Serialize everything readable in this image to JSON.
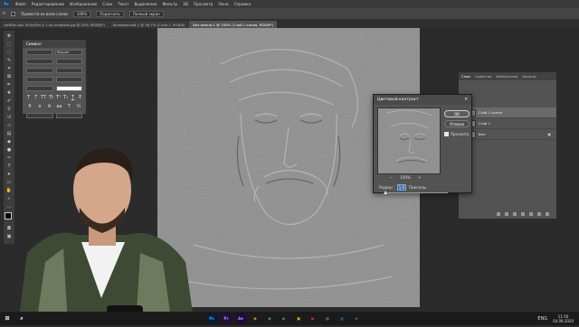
{
  "menubar": {
    "logo": "Ps",
    "items": [
      "Файл",
      "Редактирование",
      "Изображение",
      "Слои",
      "Текст",
      "Выделение",
      "Фильтр",
      "3D",
      "Просмотр",
      "Окно",
      "Справка"
    ]
  },
  "options": {
    "sample": "Привести ко всем слоям",
    "zoom": "100%",
    "fit_screen": "Подогнать",
    "full_screen": "Полный экран"
  },
  "tabs": [
    {
      "label": "peRitin-doc 3h5y9Ym-c 1 he-zmq6w6.jpg @ 25% (RGB/8*)"
    },
    {
      "label": "Безымянный-1 @ 56,7% (Слой 1, RGB/8)"
    },
    {
      "label": "Без имени-1 @ 100% (Слой 1 копия, RGB/8*)"
    }
  ],
  "char_panel": {
    "title": "Символ",
    "font_style": "Regular",
    "glyphs": [
      "T",
      "T",
      "TT",
      "Tt",
      "T¹",
      "T₁",
      "T",
      "T̶"
    ]
  },
  "layers_panel": {
    "tabs": [
      "Слои",
      "Свойства",
      "Библиотеки",
      "Каналы"
    ],
    "layers": [
      {
        "name": "Слой 1 копия"
      },
      {
        "name": "Слой 1"
      },
      {
        "name": "Фон"
      }
    ]
  },
  "dialog": {
    "title": "Цветовой контраст",
    "close": "✕",
    "ok_label": "OK",
    "cancel_label": "Отмена",
    "preview_label": "Просмотр",
    "zoom_out": "−",
    "zoom_value": "100%",
    "zoom_in": "+",
    "radius_label": "Радиус:",
    "radius_value": "1,0",
    "radius_unit": "Пикселы",
    "slider_value": 0.02
  },
  "taskbar": {
    "apps": [
      {
        "label": "Ps",
        "color": "#001e36",
        "fg": "#31a8ff"
      },
      {
        "label": "Pr",
        "color": "#2a0a3a",
        "fg": "#9999ff"
      },
      {
        "label": "Ae",
        "color": "#1f0a3a",
        "fg": "#9999ff"
      },
      {
        "label": "◉",
        "color": "#1b1b1b",
        "fg": "#e8a33d"
      },
      {
        "label": "◉",
        "color": "#1b1b1b",
        "fg": "#4caf50"
      },
      {
        "label": "▶",
        "color": "#1b1b1b",
        "fg": "#2aa1e0"
      },
      {
        "label": "▣",
        "color": "#1b1b1b",
        "fg": "#ffb900"
      },
      {
        "label": "▶",
        "color": "#1b1b1b",
        "fg": "#e53935"
      },
      {
        "label": "◎",
        "color": "#1b1b1b",
        "fg": "#ddd"
      },
      {
        "label": "▦",
        "color": "#1b1b1b",
        "fg": "#0078d7"
      },
      {
        "label": "◈",
        "color": "#1b1b1b",
        "fg": "#43a047"
      }
    ],
    "lang": "ENG",
    "time": "11:50",
    "date": "04.09.2020"
  },
  "colors": {
    "accent": "#31a8ff",
    "panel_bg": "#535353",
    "app_bg": "#2b2b2b"
  }
}
